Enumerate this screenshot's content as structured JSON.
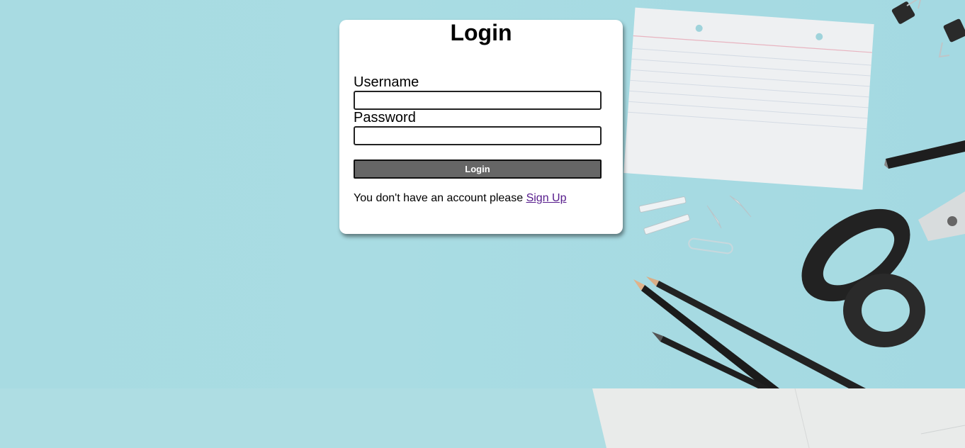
{
  "login_card": {
    "title": "Login",
    "username_label": "Username",
    "username_value": "",
    "password_label": "Password",
    "password_value": "",
    "login_button_label": "Login",
    "signup_prompt": "You don't have an account please",
    "signup_link_label": "Sign Up"
  },
  "colors": {
    "background": "#a9dce3",
    "card": "#ffffff",
    "button": "#666666",
    "link_visited": "#551a8b"
  }
}
